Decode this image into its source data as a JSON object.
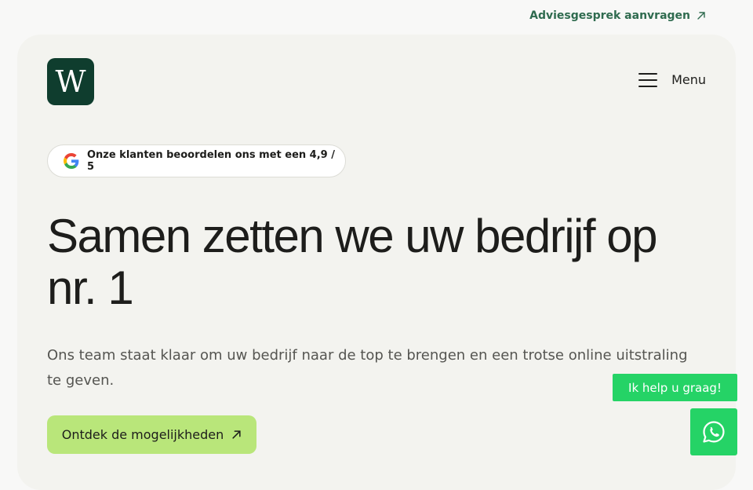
{
  "topbar": {
    "consult_link": "Adviesgesprek aanvragen",
    "arrow_icon": "arrow-up-right-icon"
  },
  "header": {
    "logo_letter": "W",
    "menu_label": "Menu",
    "menu_icon": "hamburger-icon"
  },
  "rating": {
    "icon": "google-icon",
    "text": "Onze klanten beoordelen ons met een 4,9 / 5"
  },
  "hero": {
    "headline": "Samen zetten we uw bedrijf op nr. 1",
    "subtext": "Ons team staat klaar om uw bedrijf naar de top te brengen en een trotse online uitstraling te geven.",
    "cta_label": "Ontdek de mogelijkheden"
  },
  "chat": {
    "bubble_text": "Ik help u graag!",
    "icon": "whatsapp-icon"
  },
  "colors": {
    "brand_dark": "#0f3d2e",
    "accent_green": "#b9e67a",
    "link_green": "#2f6b4f",
    "whatsapp": "#25d366"
  }
}
